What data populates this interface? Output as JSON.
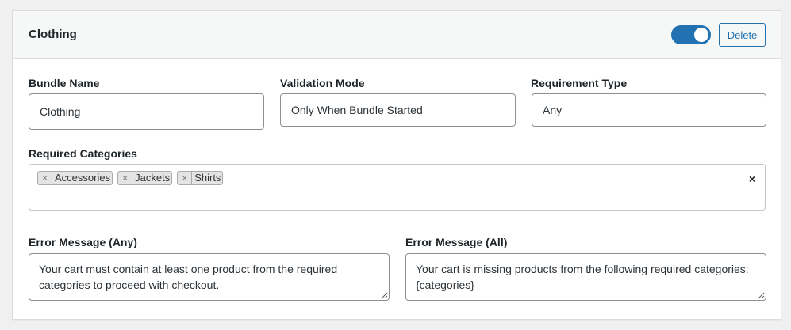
{
  "card": {
    "title": "Clothing",
    "toggle_on": true,
    "delete_label": "Delete"
  },
  "fields": {
    "bundle_name": {
      "label": "Bundle Name",
      "value": "Clothing"
    },
    "validation_mode": {
      "label": "Validation Mode",
      "value": "Only When Bundle Started"
    },
    "requirement_type": {
      "label": "Requirement Type",
      "value": "Any"
    }
  },
  "required_categories": {
    "label": "Required Categories",
    "tags": [
      {
        "remove": "×",
        "text": "Accessories"
      },
      {
        "remove": "×",
        "text": "Jackets"
      },
      {
        "remove": "×",
        "text": "Shirts"
      }
    ],
    "clear_all": "×"
  },
  "error_messages": {
    "any": {
      "label": "Error Message (Any)",
      "value": "Your cart must contain at least one product from the required categories to proceed with checkout."
    },
    "all": {
      "label": "Error Message (All)",
      "value": "Your cart is missing products from the following required categories: {categories}"
    }
  },
  "colors": {
    "accent": "#2271b1",
    "header_bg": "#f6f7f7",
    "border": "#8c8f94"
  }
}
